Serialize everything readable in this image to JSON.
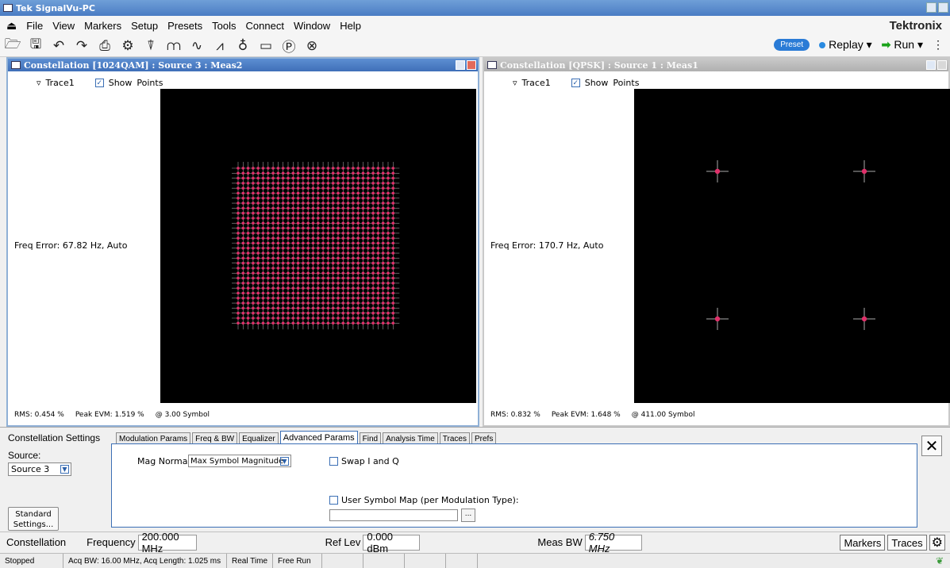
{
  "window": {
    "title": "Tek SignalVu-PC"
  },
  "menu": {
    "eject_icon": "eject-icon",
    "items": [
      "File",
      "View",
      "Markers",
      "Setup",
      "Presets",
      "Tools",
      "Connect",
      "Window",
      "Help"
    ],
    "brand": "Tektronix"
  },
  "toolbar": {
    "icons": [
      "open-icon",
      "save-icon",
      "undo-icon",
      "redo-icon",
      "print-icon",
      "settings-gear-icon",
      "marker-icon",
      "spectrum-icon",
      "time-icon",
      "freq-icon",
      "acquire-icon",
      "record-icon",
      "preset-p-icon",
      "link-icon"
    ],
    "preset_label": "Preset",
    "replay_label": "Replay ▾",
    "run_label": "Run ▾",
    "more_label": "⋮"
  },
  "panels": {
    "left": {
      "title": "Constellation [1024QAM] : Source 3 : Meas2",
      "trace_label": "Trace1",
      "show_label": "Show",
      "points_label": "Points",
      "freq_error": "Freq Error: 67.82 Hz, Auto",
      "rms": "RMS:  0.454 %",
      "peak_evm": "Peak EVM:   1.519 %",
      "symbol": "@  3.00 Symbol"
    },
    "right": {
      "title": "Constellation [QPSK] : Source 1 : Meas1",
      "trace_label": "Trace1",
      "show_label": "Show",
      "points_label": "Points",
      "freq_error": "Freq Error: 170.7 Hz, Auto",
      "rms": "RMS:  0.832 %",
      "peak_evm": "Peak EVM:   1.648 %",
      "symbol": "@  411.00 Symbol"
    }
  },
  "settings": {
    "title": "Constellation Settings",
    "source_label": "Source:",
    "source_value": "Source 3",
    "standard_btn": "Standard\nSettings...",
    "tabs": [
      "Modulation Params",
      "Freq & BW",
      "Equalizer",
      "Advanced Params",
      "Find",
      "Analysis Time",
      "Traces",
      "Prefs"
    ],
    "active_tab": "Advanced Params",
    "mag_normalize_label": "Mag Normalize:",
    "mag_normalize_value": "Max Symbol Magnitude",
    "swap_iq_label": "Swap I and Q",
    "user_symbol_map_label": "User Symbol Map (per Modulation Type):",
    "browse_label": "...",
    "close_label": "✕"
  },
  "meas_bar": {
    "measurement": "Constellation",
    "frequency_label": "Frequency",
    "frequency_value": "200.000 MHz",
    "ref_lev_label": "Ref Lev",
    "ref_lev_value": "0.000 dBm",
    "meas_bw_label": "Meas BW",
    "meas_bw_value": "6.750 MHz",
    "markers_btn": "Markers",
    "traces_btn": "Traces"
  },
  "status": {
    "state": "Stopped",
    "acq": "Acq BW: 16.00 MHz, Acq Length: 1.025 ms",
    "mode": "Real Time",
    "trigger": "Free Run"
  },
  "colors": {
    "symbol": "#e0306a",
    "accent": "#3b6fb5"
  }
}
